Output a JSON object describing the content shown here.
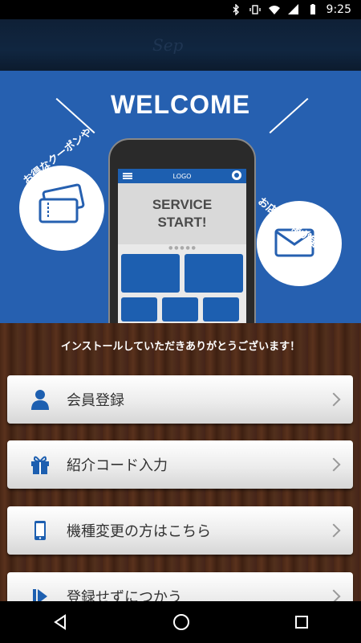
{
  "status_bar": {
    "time": "9:25",
    "icons": [
      "bluetooth-icon",
      "vibrate-icon",
      "wifi-icon",
      "signal-icon",
      "battery-icon"
    ]
  },
  "header": {
    "logo_text": "Sep"
  },
  "hero": {
    "title": "WELCOME",
    "left_bubble_text": "お得なクーポンや",
    "right_bubble_text": "お店の情報が届く！",
    "phone": {
      "bar_label": "LOGO",
      "service_line1": "SERVICE",
      "service_line2": "START!"
    }
  },
  "thanks_text": "インストールしていただきありがとうございます！",
  "menu": [
    {
      "label": "会員登録",
      "icon": "person-icon"
    },
    {
      "label": "紹介コード入力",
      "icon": "gift-icon"
    },
    {
      "label": "機種変更の方はこちら",
      "icon": "phone-icon"
    },
    {
      "label": "登録せずにつかう",
      "icon": "skip-icon"
    }
  ],
  "colors": {
    "accent": "#1d5fb0",
    "hero_bg": "#2660b0",
    "header_bg": "#102640"
  }
}
